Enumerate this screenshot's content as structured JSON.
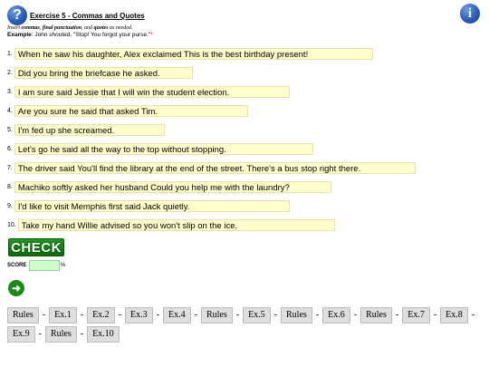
{
  "header": {
    "help_icon_glyph": "?",
    "title": "Exercise 5 - Commas and Quotes",
    "info_icon_glyph": "i",
    "instruction_prefix": "Insert ",
    "instruction_b1": "commas",
    "instruction_mid1": ", ",
    "instruction_b2": "final punctuation",
    "instruction_mid2": ", and ",
    "instruction_b3": "quotes",
    "instruction_suffix": " as needed.",
    "example_label": "Example",
    "example_text": ": John shouted, \"Stop! You forgot your purse.\"",
    "example_marker": "*"
  },
  "questions": [
    {
      "num": "1.",
      "text": "When he saw his daughter, Alex exclaimed This is the best birthday present!"
    },
    {
      "num": "2.",
      "text": "Did you bring the briefcase he asked."
    },
    {
      "num": "3.",
      "text": "I am sure said Jessie that I will win the student election."
    },
    {
      "num": "4.",
      "text": "Are you sure he said that asked Tim."
    },
    {
      "num": "5.",
      "text": "I'm fed up she screamed."
    },
    {
      "num": "6.",
      "text": "Let's go he said all the way to the top without stopping."
    },
    {
      "num": "7.",
      "text": "The driver said You'll find the library at the end of the street. There's a bus stop right there."
    },
    {
      "num": "8.",
      "text": "Machiko softly asked her husband Could you help me with the laundry?"
    },
    {
      "num": "9.",
      "text": "I'd like to visit Memphis first said Jack quietly."
    },
    {
      "num": "10.",
      "text": "Take my hand Willie advised so you won't slip on the ice."
    }
  ],
  "controls": {
    "check_label": "CHECK",
    "score_label": "SCORE",
    "score_value": "",
    "score_unit": "%",
    "next_glyph": "➜"
  },
  "nav": {
    "tabs": [
      "Rules",
      "Ex.1",
      "Ex.2",
      "Ex.3",
      "Ex.4",
      "Rules",
      "Ex.5",
      "Rules",
      "Ex.6",
      "Rules",
      "Ex.7",
      "Ex.8",
      "Ex.9",
      "Rules",
      "Ex.10"
    ],
    "separator": "-"
  }
}
